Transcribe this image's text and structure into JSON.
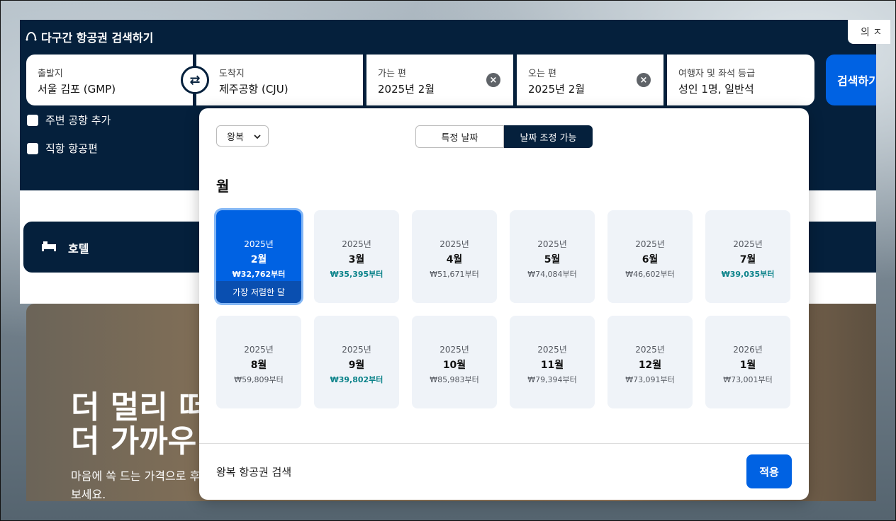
{
  "header": {
    "title": "다구간 항공권 검색하기",
    "lang_button": "의 ㅈ"
  },
  "search": {
    "origin": {
      "label": "출발지",
      "value": "서울 김포 (GMP)"
    },
    "destination": {
      "label": "도착지",
      "value": "제주공항 (CJU)"
    },
    "depart": {
      "label": "가는 편",
      "value": "2025년 2월"
    },
    "return": {
      "label": "오는 편",
      "value": "2025년 2월"
    },
    "travelers": {
      "label": "여행자 및 좌석 등급",
      "value": "성인 1명, 일반석"
    },
    "search_button": "검색하기",
    "nearby_airports": "주변 공항 추가",
    "direct_flights": "직항 항공편"
  },
  "hotel": {
    "label": "호텔"
  },
  "hero": {
    "line1": "더 멀리 떠",
    "line2": "더 가까우",
    "sub1": "마음에 쏙 드는 가격으로 후",
    "sub2": "보세요."
  },
  "popup": {
    "trip_type": "왕복",
    "tab_specific": "특정 날짜",
    "tab_flexible": "날짜 조정 가능",
    "section_title": "월",
    "months": [
      {
        "year": "2025년",
        "month": "2월",
        "price": "₩32,762부터",
        "low": true,
        "selected": true,
        "badge": "가장 저렴한 달"
      },
      {
        "year": "2025년",
        "month": "3월",
        "price": "₩35,395부터",
        "low": true
      },
      {
        "year": "2025년",
        "month": "4월",
        "price": "₩51,671부터",
        "low": false
      },
      {
        "year": "2025년",
        "month": "5월",
        "price": "₩74,084부터",
        "low": false
      },
      {
        "year": "2025년",
        "month": "6월",
        "price": "₩46,602부터",
        "low": false
      },
      {
        "year": "2025년",
        "month": "7월",
        "price": "₩39,035부터",
        "low": true
      },
      {
        "year": "2025년",
        "month": "8월",
        "price": "₩59,809부터",
        "low": false
      },
      {
        "year": "2025년",
        "month": "9월",
        "price": "₩39,802부터",
        "low": true
      },
      {
        "year": "2025년",
        "month": "10월",
        "price": "₩85,983부터",
        "low": false
      },
      {
        "year": "2025년",
        "month": "11월",
        "price": "₩79,394부터",
        "low": false
      },
      {
        "year": "2025년",
        "month": "12월",
        "price": "₩73,091부터",
        "low": false
      },
      {
        "year": "2026년",
        "month": "1월",
        "price": "₩73,001부터",
        "low": false
      }
    ],
    "footer_label": "왕복 항공권 검색",
    "apply_button": "적용"
  },
  "colors": {
    "navy": "#05203c",
    "primary": "#0062e3",
    "low_price": "#0c838a"
  }
}
